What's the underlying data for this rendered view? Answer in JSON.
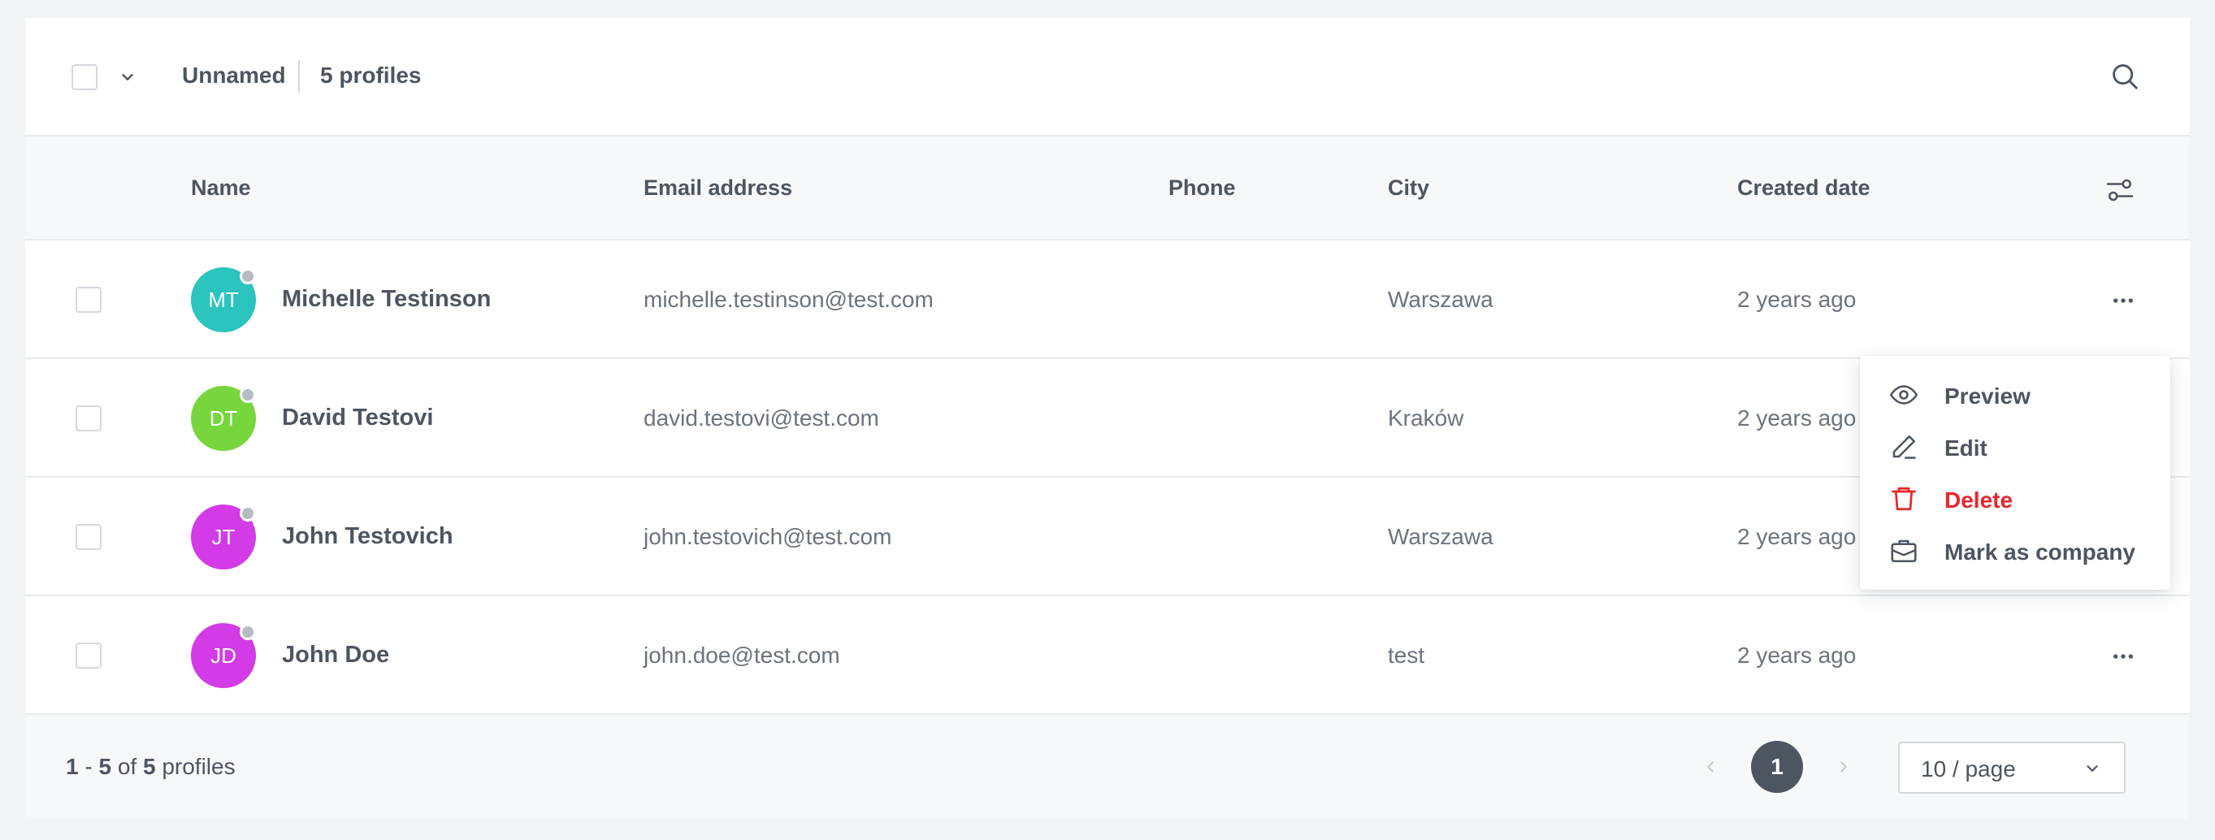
{
  "header": {
    "segment_name": "Unnamed",
    "profile_count": "5 profiles"
  },
  "columns": {
    "name": "Name",
    "email": "Email address",
    "phone": "Phone",
    "city": "City",
    "created": "Created date"
  },
  "rows": [
    {
      "initials": "MT",
      "name": "Michelle Testinson",
      "email": "michelle.testinson@test.com",
      "phone": "",
      "city": "Warszawa",
      "created": "2 years ago",
      "avatar_color": "#2bc4be"
    },
    {
      "initials": "DT",
      "name": "David Testovi",
      "email": "david.testovi@test.com",
      "phone": "",
      "city": "Kraków",
      "created": "2 years ago",
      "avatar_color": "#76d63c"
    },
    {
      "initials": "JT",
      "name": "John Testovich",
      "email": "john.testovich@test.com",
      "phone": "",
      "city": "Warszawa",
      "created": "2 years ago",
      "avatar_color": "#d23be6"
    },
    {
      "initials": "JD",
      "name": "John Doe",
      "email": "john.doe@test.com",
      "phone": "",
      "city": "test",
      "created": "2 years ago",
      "avatar_color": "#d23be6"
    }
  ],
  "row_menu": {
    "items": [
      {
        "label": "Preview",
        "icon": "eye-icon"
      },
      {
        "label": "Edit",
        "icon": "pencil-icon"
      },
      {
        "label": "Delete",
        "icon": "trash-icon",
        "color": "#e8262c"
      },
      {
        "label": "Mark as company",
        "icon": "briefcase-icon"
      }
    ]
  },
  "footer": {
    "range_start": "1",
    "range_end": "5",
    "total": "5",
    "of_label": "of",
    "unit_label": "profiles",
    "current_page": "1",
    "page_size": "10 / page"
  },
  "colors": {
    "accent_dark": "#4d5561",
    "danger": "#e8262c",
    "border": "#e8ebee"
  }
}
